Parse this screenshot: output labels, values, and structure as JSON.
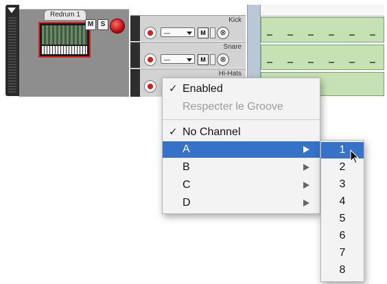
{
  "instrument": {
    "name": "Redrum 1",
    "mute_label": "M",
    "solo_label": "S"
  },
  "lanes": [
    {
      "name": "Kick",
      "channel_value": "—",
      "mute_label": "M",
      "remove_glyph": "⊗"
    },
    {
      "name": "Snare",
      "channel_value": "—",
      "mute_label": "M",
      "remove_glyph": "⊗"
    },
    {
      "name": "Hi-Hats",
      "channel_value": "",
      "mute_label": "",
      "remove_glyph": ""
    }
  ],
  "context_menu": {
    "items": [
      {
        "label": "Enabled",
        "checked": true,
        "enabled": true
      },
      {
        "label": "Respecter le Groove",
        "checked": false,
        "enabled": false
      },
      {
        "label": "No Channel",
        "checked": true,
        "enabled": true
      },
      {
        "label": "A",
        "submenu": true,
        "highlighted": true
      },
      {
        "label": "B",
        "submenu": true
      },
      {
        "label": "C",
        "submenu": true
      },
      {
        "label": "D",
        "submenu": true
      }
    ],
    "check_glyph": "✓"
  },
  "submenu": {
    "items": [
      "1",
      "2",
      "3",
      "4",
      "5",
      "6",
      "7",
      "8"
    ],
    "highlighted_index": 0
  },
  "colors": {
    "highlight": "#3572c8",
    "record_red": "#e01818",
    "pattern_green": "#c6e2b5"
  },
  "icons": {
    "collapse": "triangle-down-icon",
    "record": "record-icon",
    "remove": "close-circle-icon",
    "submenu_arrow": "triangle-right-icon",
    "cursor": "mouse-pointer-icon"
  }
}
